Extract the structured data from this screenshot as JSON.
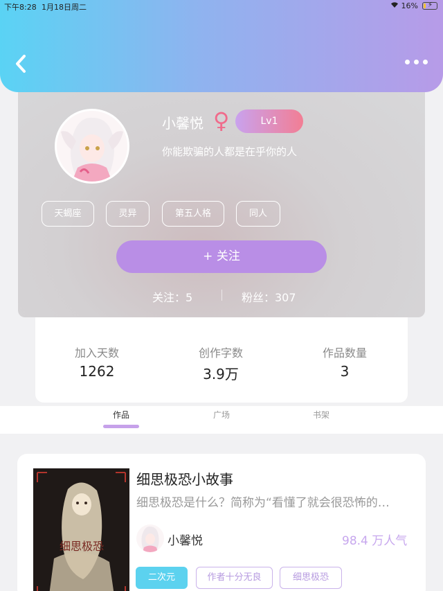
{
  "status_bar": {
    "time": "下午8:28",
    "date": "1月18日周二",
    "battery": "16%",
    "battery_level": 0.16
  },
  "nav": {
    "back_icon": "chevron-left-icon",
    "more_icon": "more-dots-icon"
  },
  "profile": {
    "name": "小馨悦",
    "gender_symbol": "♀",
    "level": "Lv1",
    "signature": "你能欺骗的人都是在乎你的人",
    "tags": [
      "天蝎座",
      "灵异",
      "第五人格",
      "同人"
    ],
    "follow_button": "+  关注",
    "following_label": "关注：5",
    "fans_label": "粉丝：307"
  },
  "stats": [
    {
      "label": "加入天数",
      "value": "1262"
    },
    {
      "label": "创作字数",
      "value": "3.9万"
    },
    {
      "label": "作品数量",
      "value": "3"
    }
  ],
  "tabs": [
    {
      "label": "作品",
      "active": true
    },
    {
      "label": "广场",
      "active": false
    },
    {
      "label": "书架",
      "active": false
    }
  ],
  "work": {
    "title": "细思极恐小故事",
    "description": "细思极恐是什么？简称为“看懂了就会很恐怖的…",
    "author": "小馨悦",
    "popularity": "98.4 万人气",
    "tags": [
      "二次元",
      "作者十分无良",
      "细思极恐"
    ],
    "cover_text": "细思极恐"
  },
  "colors": {
    "header_start": "#5ad3f4",
    "header_end": "#b79be8",
    "accent_purple": "#b98ee6",
    "gender_pink": "#f06b8b",
    "tag_cyan": "#5cd2ef"
  }
}
